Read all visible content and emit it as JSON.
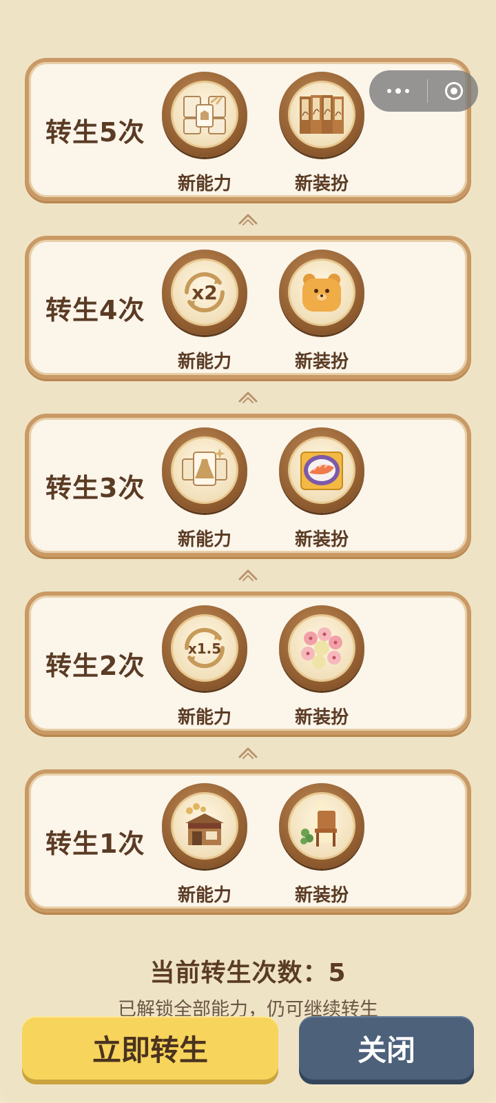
{
  "capsule": {
    "more_icon": "more-dots-icon",
    "close_icon": "target-circle-icon"
  },
  "tiers": [
    {
      "title": "转生5次",
      "rewards": [
        {
          "label": "新能力",
          "icon": "clothing-cards-icon"
        },
        {
          "label": "新装扮",
          "icon": "folding-screen-icon"
        }
      ]
    },
    {
      "title": "转生4次",
      "rewards": [
        {
          "label": "新能力",
          "icon": "x2-multiplier-icon"
        },
        {
          "label": "新装扮",
          "icon": "bear-cushion-icon"
        }
      ]
    },
    {
      "title": "转生3次",
      "rewards": [
        {
          "label": "新能力",
          "icon": "dress-card-icon"
        },
        {
          "label": "新装扮",
          "icon": "sushi-plate-icon"
        }
      ]
    },
    {
      "title": "转生2次",
      "rewards": [
        {
          "label": "新能力",
          "icon": "x1.5-multiplier-icon"
        },
        {
          "label": "新装扮",
          "icon": "flower-bouquet-icon"
        }
      ]
    },
    {
      "title": "转生1次",
      "rewards": [
        {
          "label": "新能力",
          "icon": "shop-coins-icon"
        },
        {
          "label": "新装扮",
          "icon": "wooden-chair-icon"
        }
      ]
    }
  ],
  "footer": {
    "count_text": "当前转生次数：5",
    "hint_text": "已解锁全部能力，仍可继续转生"
  },
  "buttons": {
    "primary": "立即转生",
    "close": "关闭"
  },
  "colors": {
    "text": "#5a3b24",
    "card_border": "#c99a66",
    "primary_button": "#f7d45b",
    "close_button": "#4d617b"
  }
}
